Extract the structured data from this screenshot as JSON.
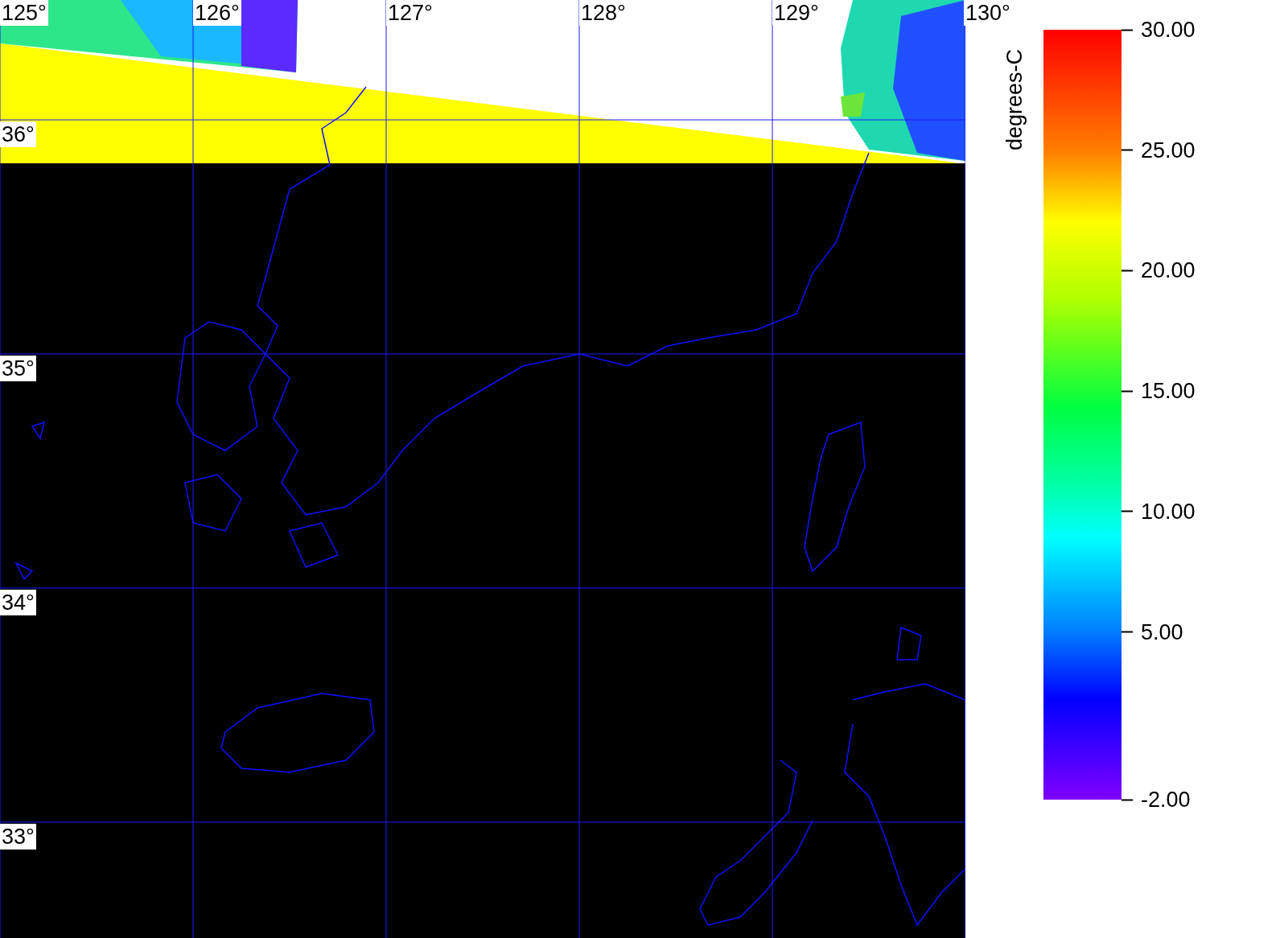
{
  "map": {
    "lon_labels": [
      "125°",
      "126°",
      "127°",
      "128°",
      "129°",
      "130°"
    ],
    "lat_labels": [
      "36°",
      "35°",
      "34°",
      "33°"
    ]
  },
  "colorbar": {
    "title": "degrees-C",
    "tick_labels": [
      "30.00",
      "25.00",
      "20.00",
      "15.00",
      "10.00",
      "5.00",
      "-2.00"
    ]
  }
}
